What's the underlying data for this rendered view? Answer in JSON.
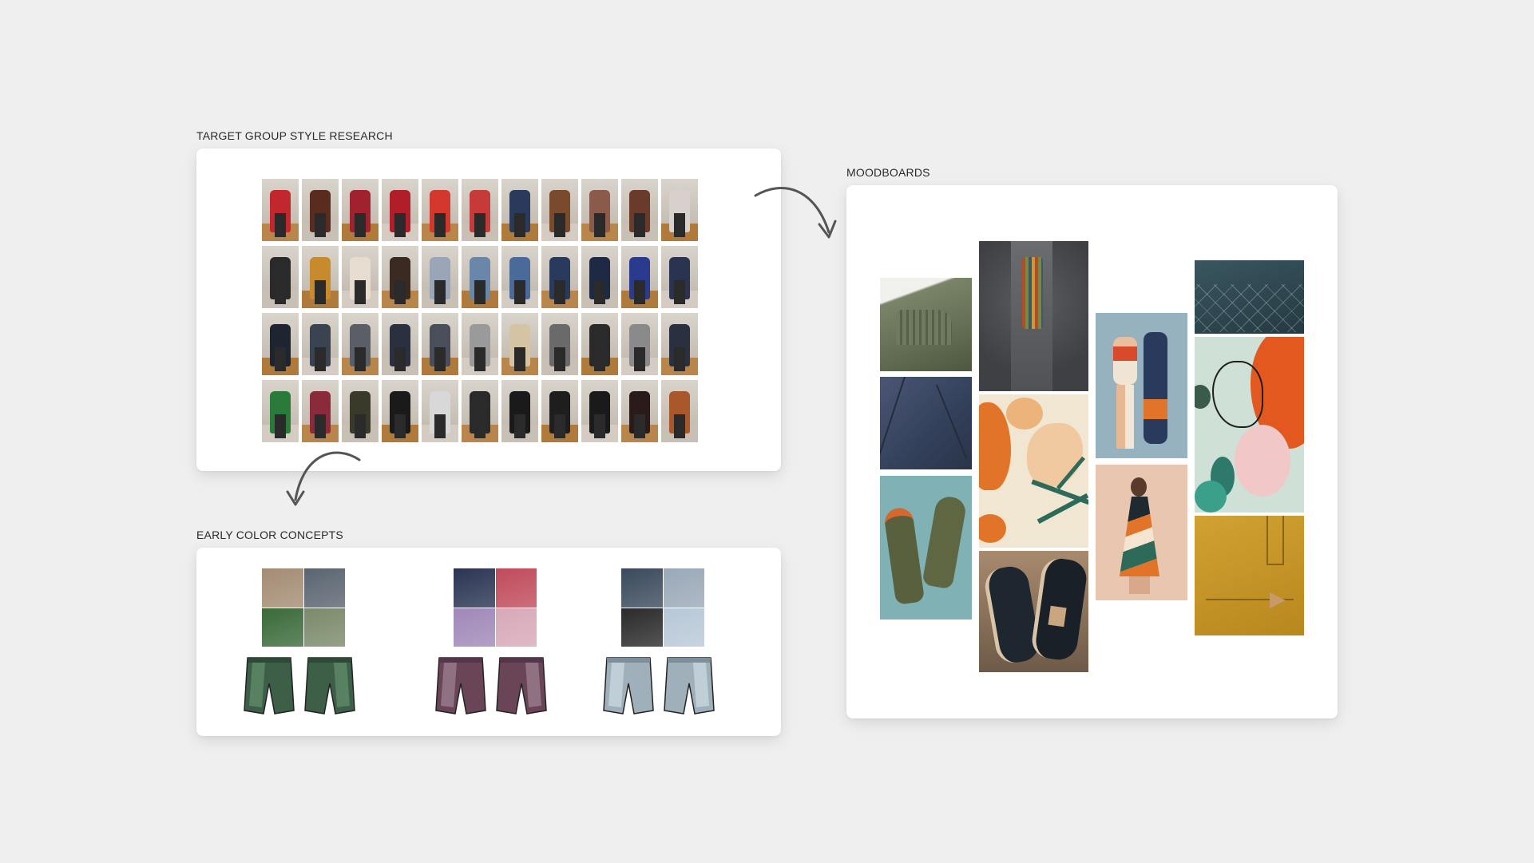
{
  "labels": {
    "research": "TARGET GROUP STYLE RESEARCH",
    "concepts": "EARLY COLOR CONCEPTS",
    "moodboards": "MOODBOARDS"
  },
  "research_palette": [
    [
      "#c1272d",
      "#5a2b1f",
      "#a0222e",
      "#b11e2a",
      "#d4372c",
      "#c73a3a",
      "#2a3a5c",
      "#7a4a2c",
      "#8a5a4a",
      "#6a3a2a",
      "#d8d0cc"
    ],
    [
      "#2a2a2a",
      "#c78a2c",
      "#e6dccf",
      "#3a2a22",
      "#9aa6b8",
      "#6a86a8",
      "#4a6a9a",
      "#2a3a5c",
      "#1e2a44",
      "#2a3a8c",
      "#2a3450"
    ],
    [
      "#1e2430",
      "#3a4450",
      "#5a5e66",
      "#2a3040",
      "#4a4e5a",
      "#9a9a9a",
      "#d4c4a4",
      "#6a6a6a",
      "#2a2a2a",
      "#8a8a8a",
      "#2a3040"
    ],
    [
      "#2a7a3a",
      "#8a2a3a",
      "#3a3a2a",
      "#1a1a1a",
      "#d8d8d8",
      "#2a2a2a",
      "#1a1a1a",
      "#1e1e1e",
      "#1a1a1a",
      "#2a1a1a",
      "#a8582a"
    ]
  ],
  "concept_palettes": [
    {
      "collage": [
        "#a48c74",
        "#5a6470",
        "#3a6a3a",
        "#7a8a6a"
      ],
      "shorts": [
        "#3d5e47",
        "#5f8a6b",
        "#2e4a37"
      ]
    },
    {
      "collage": [
        "#2a3452",
        "#c04a5a",
        "#a088b8",
        "#d8a8b8"
      ],
      "shorts": [
        "#6a4558",
        "#9a7a8e",
        "#55354a"
      ]
    },
    {
      "collage": [
        "#3a4a5c",
        "#9aa8b8",
        "#2a2a2a",
        "#b8c8d8"
      ],
      "shorts": [
        "#9fb0bb",
        "#c8d7df",
        "#7d8f9a"
      ]
    }
  ],
  "moodboard_colors": {
    "olive": "#6f7a5e",
    "navy": "#3e4a66",
    "teal": "#7fb1b5",
    "tweed": "#4a4c50",
    "cream": "#f1e6d2",
    "orange": "#e2742a",
    "peach": "#e8c6b0",
    "slate": "#2e4650",
    "mustard": "#c89a2a",
    "mint": "#cfe0d6"
  }
}
